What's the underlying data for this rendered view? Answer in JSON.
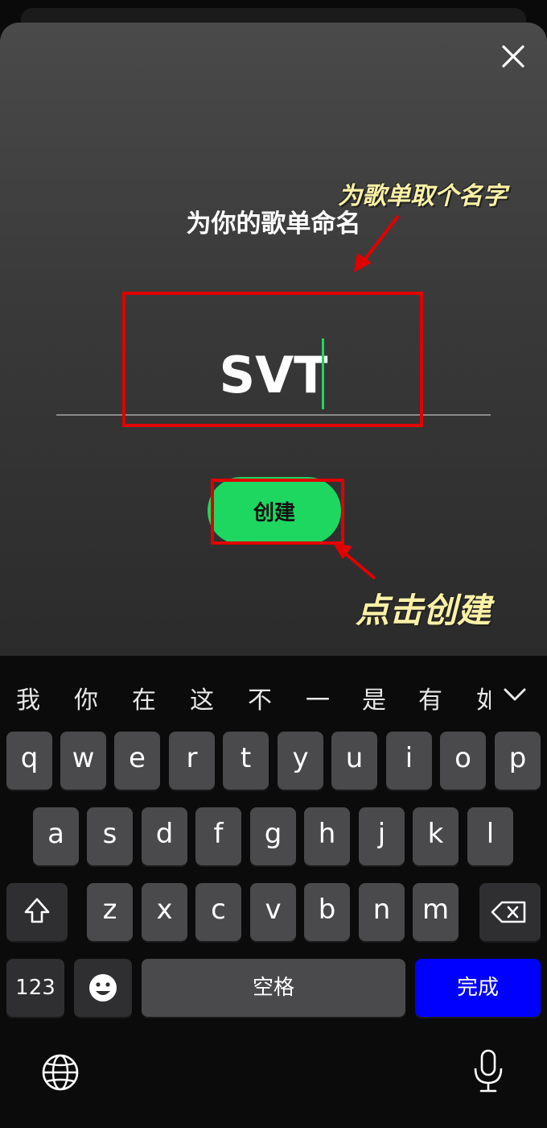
{
  "sheet": {
    "title": "为你的歌单命名",
    "playlist_name": "SVT",
    "create_label": "创建"
  },
  "annotations": {
    "hint_name": "为歌单取个名字",
    "hint_create": "点击创建"
  },
  "keyboard": {
    "candidates": [
      "我",
      "你",
      "在",
      "这",
      "不",
      "一",
      "是",
      "有",
      "如"
    ],
    "row1": [
      "q",
      "w",
      "e",
      "r",
      "t",
      "y",
      "u",
      "i",
      "o",
      "p"
    ],
    "row2": [
      "a",
      "s",
      "d",
      "f",
      "g",
      "h",
      "j",
      "k",
      "l"
    ],
    "row3": [
      "z",
      "x",
      "c",
      "v",
      "b",
      "n",
      "m"
    ],
    "numbers_label": "123",
    "space_label": "空格",
    "done_label": "完成",
    "icons": {
      "shift": "shift-icon",
      "delete": "delete-icon",
      "emoji": "emoji-icon",
      "globe": "globe-icon",
      "mic": "microphone-icon",
      "collapse": "chevron-down-icon",
      "close": "close-icon"
    }
  },
  "colors": {
    "accent_green": "#1ed760",
    "done_key": "#0000ff",
    "annotation_red": "#e00000",
    "annotation_text": "#fbf1a6"
  }
}
